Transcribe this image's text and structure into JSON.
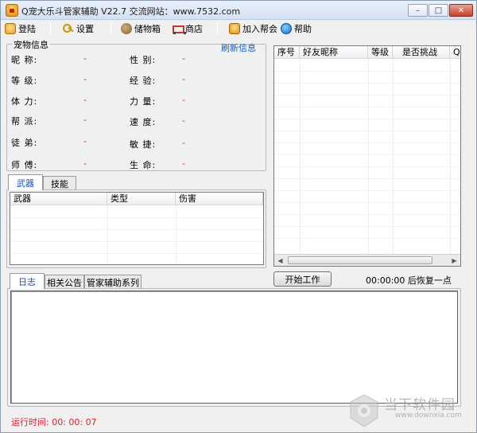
{
  "window": {
    "title": "Q宠大乐斗管家辅助 V22.7 交流网站：www.7532.com",
    "minimize": "–",
    "maximize": "□",
    "close": "✕"
  },
  "toolbar": {
    "login": "登陆",
    "settings": "设置",
    "storage": "储物箱",
    "shop": "商店",
    "join_guild": "加入帮会",
    "help": "帮助"
  },
  "pet_info": {
    "title": "宠物信息",
    "refresh": "刷新信息",
    "left": [
      {
        "label": "昵  称:",
        "value": "-"
      },
      {
        "label": "等  级:",
        "value": "-"
      },
      {
        "label": "体  力:",
        "value": "-"
      },
      {
        "label": "帮  派:",
        "value": "-"
      },
      {
        "label": "徒  弟:",
        "value": "-"
      },
      {
        "label": "师  傅:",
        "value": "-"
      }
    ],
    "right": [
      {
        "label": "性  别:",
        "value": "-"
      },
      {
        "label": "经  验:",
        "value": "-"
      },
      {
        "label": "力  量:",
        "value": "-"
      },
      {
        "label": "速  度:",
        "value": "-"
      },
      {
        "label": "敏  捷:",
        "value": "-"
      },
      {
        "label": "生  命:",
        "value": "-"
      }
    ]
  },
  "equip_tabs": [
    "武器",
    "技能"
  ],
  "weapon_table": {
    "columns": [
      "武器",
      "类型",
      "伤害"
    ]
  },
  "friends_table": {
    "columns": [
      "序号",
      "好友昵称",
      "等级",
      "是否挑战",
      "QQ"
    ]
  },
  "log_tabs": [
    "日志",
    "相关公告",
    "管家辅助系列"
  ],
  "start_button": "开始工作",
  "countdown": "00:00:00 后恢复一点",
  "runtime": "运行时间: 00: 00: 07",
  "watermark": {
    "text": "当下软件园",
    "url": "www.downxia.com"
  }
}
